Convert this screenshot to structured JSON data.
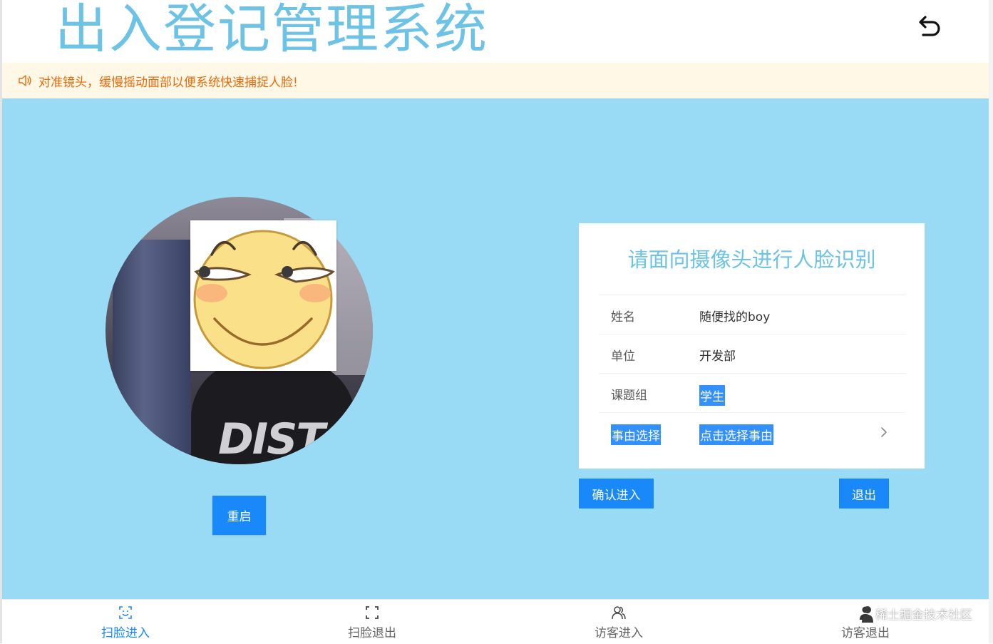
{
  "app": {
    "title": "出入登记管理系统"
  },
  "notice": {
    "text": "对准镜头，缓慢摇动面部以便系统快速捕捉人脸!",
    "icon": "volume-icon",
    "color": "#ed6a0c",
    "background": "#fff8e6"
  },
  "camera": {
    "shirt_text": "DIST",
    "restart_label": "重启"
  },
  "card": {
    "title": "请面向摄像头进行人脸识别",
    "rows": [
      {
        "label": "姓名",
        "value": "随便找的boy"
      },
      {
        "label": "单位",
        "value": "开发部"
      },
      {
        "label": "课题组",
        "value": "学生"
      },
      {
        "label": "事由选择",
        "value": "点击选择事由"
      }
    ]
  },
  "actions": {
    "confirm_label": "确认进入",
    "exit_label": "退出"
  },
  "tabbar": {
    "tabs": [
      {
        "label": "扫脸进入",
        "icon": "face-scan-icon",
        "active": true
      },
      {
        "label": "扫脸退出",
        "icon": "scan-frame-icon",
        "active": false
      },
      {
        "label": "访客进入",
        "icon": "friends-icon",
        "active": false
      },
      {
        "label": "访客退出",
        "icon": "user-icon",
        "active": false
      }
    ]
  },
  "watermark": {
    "text": "稀土掘金技术社区"
  },
  "colors": {
    "accent": "#1989fa",
    "title": "#6cc3e6",
    "main_background": "#99dbf5"
  }
}
